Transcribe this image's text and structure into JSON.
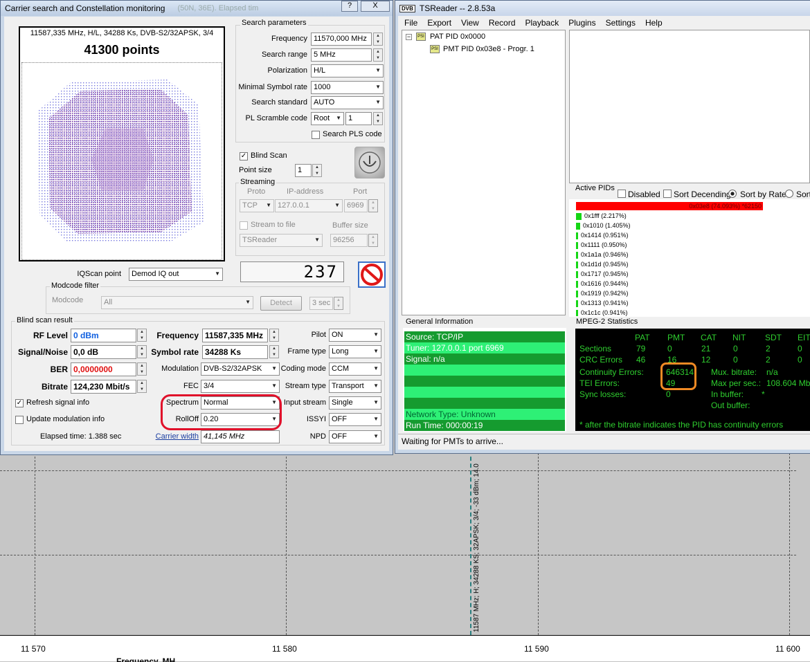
{
  "spectrum": {
    "x_ticks": [
      "11 570",
      "11 580",
      "11 590",
      "11 600"
    ],
    "x_axis_label_partial": "Frequency, MH",
    "marker_label": "11587 MHz; H; 34288 KS; 32APSK; 3/4; -33 dBm; 14.0"
  },
  "scan_window": {
    "title": "Carrier search and Constellation monitoring",
    "title_behind": "(50N, 36E). Elapsed tim",
    "title_buttons": [
      "?",
      "X"
    ],
    "constellation": {
      "header": "11587,335 MHz, H/L, 34288 Ks, DVB-S2/32APSK, 3/4",
      "points": "41300 points"
    },
    "search_params": {
      "title": "Search parameters",
      "frequency_label": "Frequency",
      "frequency_value": "11570,000 MHz",
      "search_range_label": "Search range",
      "search_range_value": "5 MHz",
      "polarization_label": "Polarization",
      "polarization_value": "H/L",
      "min_sr_label": "Minimal Symbol rate",
      "min_sr_value": "1000",
      "search_std_label": "Search standard",
      "search_std_value": "AUTO",
      "pl_scramble_label": "PL Scramble code",
      "pl_scramble_mode": "Root",
      "pl_scramble_value": "1",
      "search_pls_label": "Search PLS code"
    },
    "blind_scan_label": "Blind Scan",
    "point_size_label": "Point size",
    "point_size_value": "1",
    "streaming": {
      "title": "Streaming",
      "proto_header": "Proto",
      "ip_header": "IP-address",
      "port_header": "Port",
      "proto_value": "TCP",
      "ip_value": "127.0.0.1",
      "port_value": "6969",
      "stream_to_file_label": "Stream to file",
      "buffer_size_label": "Buffer size",
      "target_value": "TSReader",
      "buffer_value": "96256"
    },
    "counter_value": "237",
    "iqscan_label": "IQScan point",
    "iqscan_value": "Demod IQ out",
    "modcode_filter": {
      "title": "Modcode filter",
      "label": "Modcode",
      "value": "All",
      "detect_button": "Detect",
      "seconds_value": "3 sec"
    },
    "result": {
      "title": "Blind scan result",
      "rf_level_label": "RF Level",
      "rf_level_value": "0 dBm",
      "snr_label": "Signal/Noise",
      "snr_value": "0,0 dB",
      "ber_label": "BER",
      "ber_value": "0,0000000",
      "bitrate_label": "Bitrate",
      "bitrate_value": "124,230 Mbit/s",
      "frequency_label": "Frequency",
      "frequency_value": "11587,335 MHz",
      "symbol_rate_label": "Symbol rate",
      "symbol_rate_value": "34288 Ks",
      "modulation_label": "Modulation",
      "modulation_value": "DVB-S2/32APSK",
      "fec_label": "FEC",
      "fec_value": "3/4",
      "spectrum_label": "Spectrum",
      "spectrum_value": "Normal",
      "rolloff_label": "RollOff",
      "rolloff_value": "0.20",
      "carrier_width_label": "Carrier width",
      "carrier_width_value": "41,145 MHz",
      "pilot_label": "Pilot",
      "pilot_value": "ON",
      "frame_type_label": "Frame type",
      "frame_type_value": "Long",
      "coding_mode_label": "Coding mode",
      "coding_mode_value": "CCM",
      "stream_type_label": "Stream type",
      "stream_type_value": "Transport",
      "input_stream_label": "Input stream",
      "input_stream_value": "Single",
      "issyi_label": "ISSYI",
      "issyi_value": "OFF",
      "npd_label": "NPD",
      "npd_value": "OFF",
      "refresh_label": "Refresh signal info",
      "update_mod_label": "Update modulation info",
      "elapsed_label": "Elapsed time: 1.388 sec"
    }
  },
  "tsreader": {
    "title": "TSReader -- 2.8.53a",
    "logo": "DVB",
    "menu": [
      "File",
      "Export",
      "View",
      "Record",
      "Playback",
      "Plugins",
      "Settings",
      "Help"
    ],
    "tree": {
      "root": "PAT PID 0x0000",
      "child": "PMT PID 0x03e8 - Progr. 1",
      "icon_text": "PSI"
    },
    "active_pids": {
      "title": "Active PIDs",
      "disabled_label": "Disabled",
      "sort_desc_label": "Sort Decending",
      "sort_rate_label": "Sort by Rate",
      "sort_other_label": "Sort",
      "top_row": "0x03e8 (74.093%) *62150",
      "rows": [
        "0x1fff (2.217%)",
        "0x1010 (1.405%)",
        "0x1414 (0.951%)",
        "0x1111 (0.950%)",
        "0x1a1a (0.946%)",
        "0x1d1d (0.945%)",
        "0x1717 (0.945%)",
        "0x1616 (0.944%)",
        "0x1919 (0.942%)",
        "0x1313 (0.941%)",
        "0x1c1c (0.941%)"
      ]
    },
    "general_info": {
      "title": "General Information",
      "rows": [
        "Source: TCP/IP",
        "Tuner: 127.0.0.1 port 6969",
        "Signal: n/a",
        "",
        "",
        "",
        "",
        "Network Type: Unknown",
        "Run Time: 000:00:19"
      ]
    },
    "mpeg_stats": {
      "title": "MPEG-2 Statistics",
      "headers": [
        "PAT",
        "PMT",
        "CAT",
        "NIT",
        "SDT",
        "EIT"
      ],
      "sections_label": "Sections",
      "sections": [
        "79",
        "0",
        "21",
        "0",
        "2",
        "0"
      ],
      "crc_label": "CRC Errors",
      "crc": [
        "46",
        "16",
        "12",
        "0",
        "2",
        "0"
      ],
      "continuity_label": "Continuity Errors:",
      "continuity_value": "646314",
      "tei_label": "TEI Errors:",
      "tei_value": "49",
      "sync_label": "Sync losses:",
      "sync_value": "0",
      "mux_label": "Mux. bitrate:",
      "mux_value": "n/a",
      "maxsec_label": "Max per sec.:",
      "maxsec_value": "108.604 Mb",
      "inbuf_label": "In buffer:",
      "inbuf_value": "*",
      "outbuf_label": "Out buffer:",
      "footnote": "* after the bitrate indicates the PID has continuity errors"
    },
    "status": "Waiting for PMTs to arrive..."
  },
  "colors": {
    "red_highlight": "#e0102a",
    "orange_highlight": "#f08a24",
    "general_info_dark": "#159b2f",
    "general_info_light": "#2ef076",
    "pid_bar_main": "#ff0000",
    "pid_bar": "#15d615",
    "rf_value": "#1060e0",
    "ber_value": "#e01010"
  }
}
